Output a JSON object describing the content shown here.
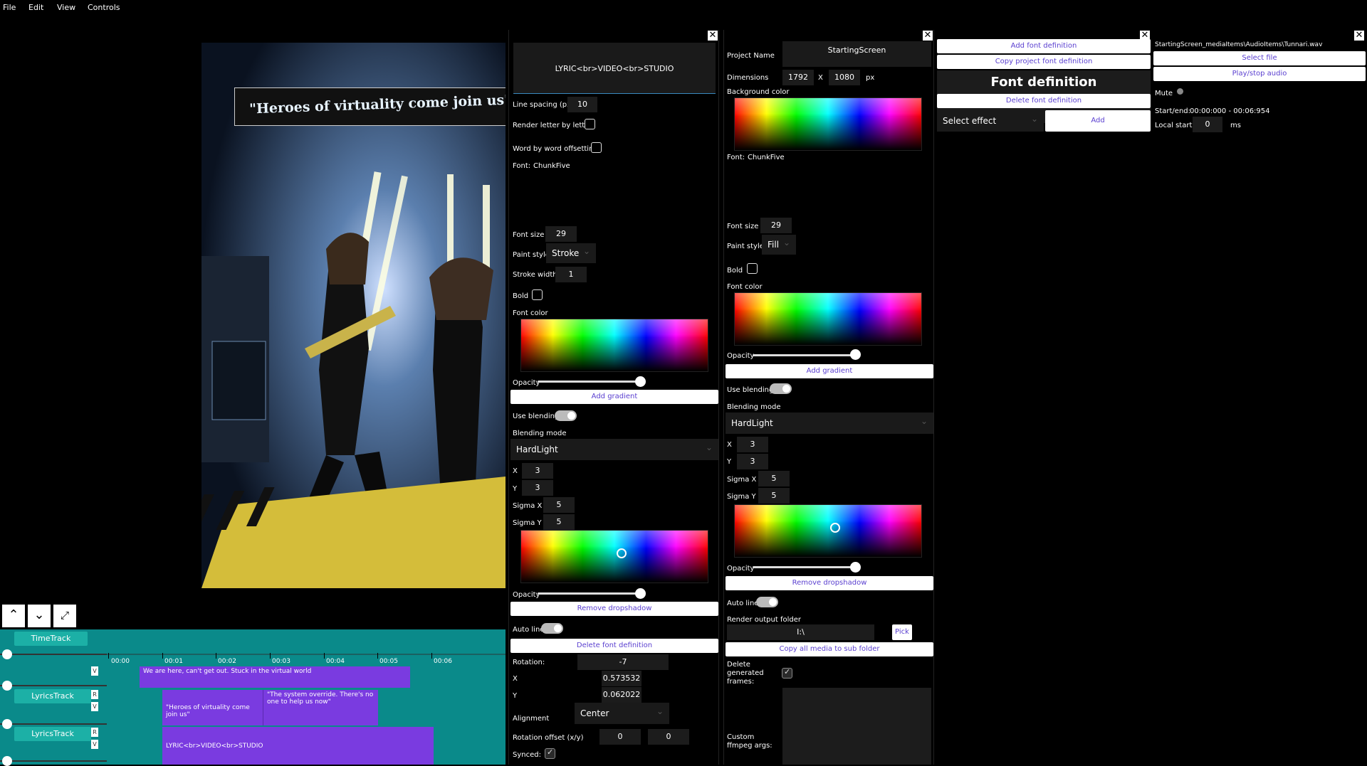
{
  "menu": {
    "file": "File",
    "edit": "Edit",
    "view": "View",
    "controls": "Controls"
  },
  "preview": {
    "lyric": "\"Heroes of virtuality come join us\""
  },
  "text_panel": {
    "text_value": "LYRIC<br>VIDEO<br>STUDIO",
    "line_spacing_label": "Line spacing (px)",
    "line_spacing": "10",
    "render_letter_label": "Render letter by letter",
    "word_offset_label": "Word by word offsetting",
    "font_label": "Font:",
    "font_name": "ChunkFive",
    "font_size_label": "Font size",
    "font_size": "29",
    "paint_style_label": "Paint style",
    "paint_style": "Stroke",
    "stroke_width_label": "Stroke width",
    "stroke_width": "1",
    "bold_label": "Bold",
    "font_color_label": "Font color",
    "opacity_label": "Opacity",
    "opacity": 0.9,
    "add_gradient": "Add gradient",
    "use_blending_label": "Use blending",
    "use_blending": true,
    "blending_mode_label": "Blending mode",
    "blending_mode": "HardLight",
    "x_label": "X",
    "x": "3",
    "y_label": "Y",
    "y": "3",
    "sigma_x_label": "Sigma X",
    "sigma_x": "5",
    "sigma_y_label": "Sigma Y",
    "sigma_y": "5",
    "shadow_opacity_label": "Opacity",
    "shadow_opacity": 0.9,
    "remove_dropshadow": "Remove dropshadow",
    "auto_line_label": "Auto line",
    "auto_line": true,
    "delete_font_definition": "Delete font definition",
    "rotation_label": "Rotation:",
    "rotation": "-7",
    "pos_x_label": "X",
    "pos_x": "0.573532",
    "pos_y_label": "Y",
    "pos_y": "0.062022",
    "alignment_label": "Alignment",
    "alignment": "Center",
    "rotation_offset_label": "Rotation offset (x/y)",
    "rotation_offset_x": "0",
    "rotation_offset_y": "0",
    "synced_label": "Synced:",
    "synced": true
  },
  "project_panel": {
    "project_name_label": "Project Name",
    "project_name": "StartingScreen",
    "dimensions_label": "Dimensions",
    "width": "1792",
    "x_sep": "X",
    "height": "1080",
    "unit": "px",
    "background_color_label": "Background color",
    "font_label": "Font:",
    "font_name": "ChunkFive",
    "font_size_label": "Font size",
    "font_size": "29",
    "paint_style_label": "Paint style",
    "paint_style": "Fill",
    "bold_label": "Bold",
    "font_color_label": "Font color",
    "opacity_label": "Opacity",
    "opacity": 0.9,
    "add_gradient": "Add gradient",
    "use_blending_label": "Use blending",
    "use_blending": true,
    "blending_mode_label": "Blending mode",
    "blending_mode": "HardLight",
    "x_label": "X",
    "x": "3",
    "y_label": "Y",
    "y": "3",
    "sigma_x_label": "Sigma X",
    "sigma_x": "5",
    "sigma_y_label": "Sigma Y",
    "sigma_y": "5",
    "shadow_opacity_label": "Opacity",
    "shadow_opacity": 0.9,
    "remove_dropshadow": "Remove dropshadow",
    "auto_line_label": "Auto line",
    "auto_line": true,
    "render_output_label": "Render output folder",
    "render_output": "I:\\",
    "pick": "Pick",
    "copy_media": "Copy all media to sub folder",
    "delete_frames_label": "Delete generated frames:",
    "delete_frames": true,
    "ffmpeg_label": "Custom ffmpeg args:"
  },
  "font_def_panel": {
    "add_font_definition": "Add font definition",
    "copy_project_font": "Copy project font definition",
    "title": "Font definition",
    "delete_font_definition": "Delete font definition",
    "select_effect": "Select effect",
    "add": "Add"
  },
  "audio_panel": {
    "path": "StartingScreen_mediaItems\\AudioItems\\Tunnari.wav",
    "select_file": "Select file",
    "play_stop": "Play/stop audio",
    "mute_label": "Mute",
    "startend_label": "Start/end:",
    "startend": "00:00:000 - 00:06:954",
    "local_start_label": "Local start:",
    "local_start": "0",
    "local_unit": "ms"
  },
  "timeline": {
    "ticks": [
      "00:00",
      "00:01",
      "00:02",
      "00:03",
      "00:04",
      "00:05",
      "00:06"
    ],
    "tracks": [
      {
        "name": "TimeTrack"
      },
      {
        "name": "LyricsTrack"
      },
      {
        "name": "LyricsTrack"
      }
    ],
    "clips": [
      {
        "text": "We are here, can't get out. Stuck in the virtual world"
      },
      {
        "text": "\"Heroes of virtuality come join us\""
      },
      {
        "text": "\"The system override. There's no one to help us now\""
      },
      {
        "text": "LYRIC<br>VIDEO<br>STUDIO"
      }
    ],
    "r": "R",
    "v": "V"
  }
}
